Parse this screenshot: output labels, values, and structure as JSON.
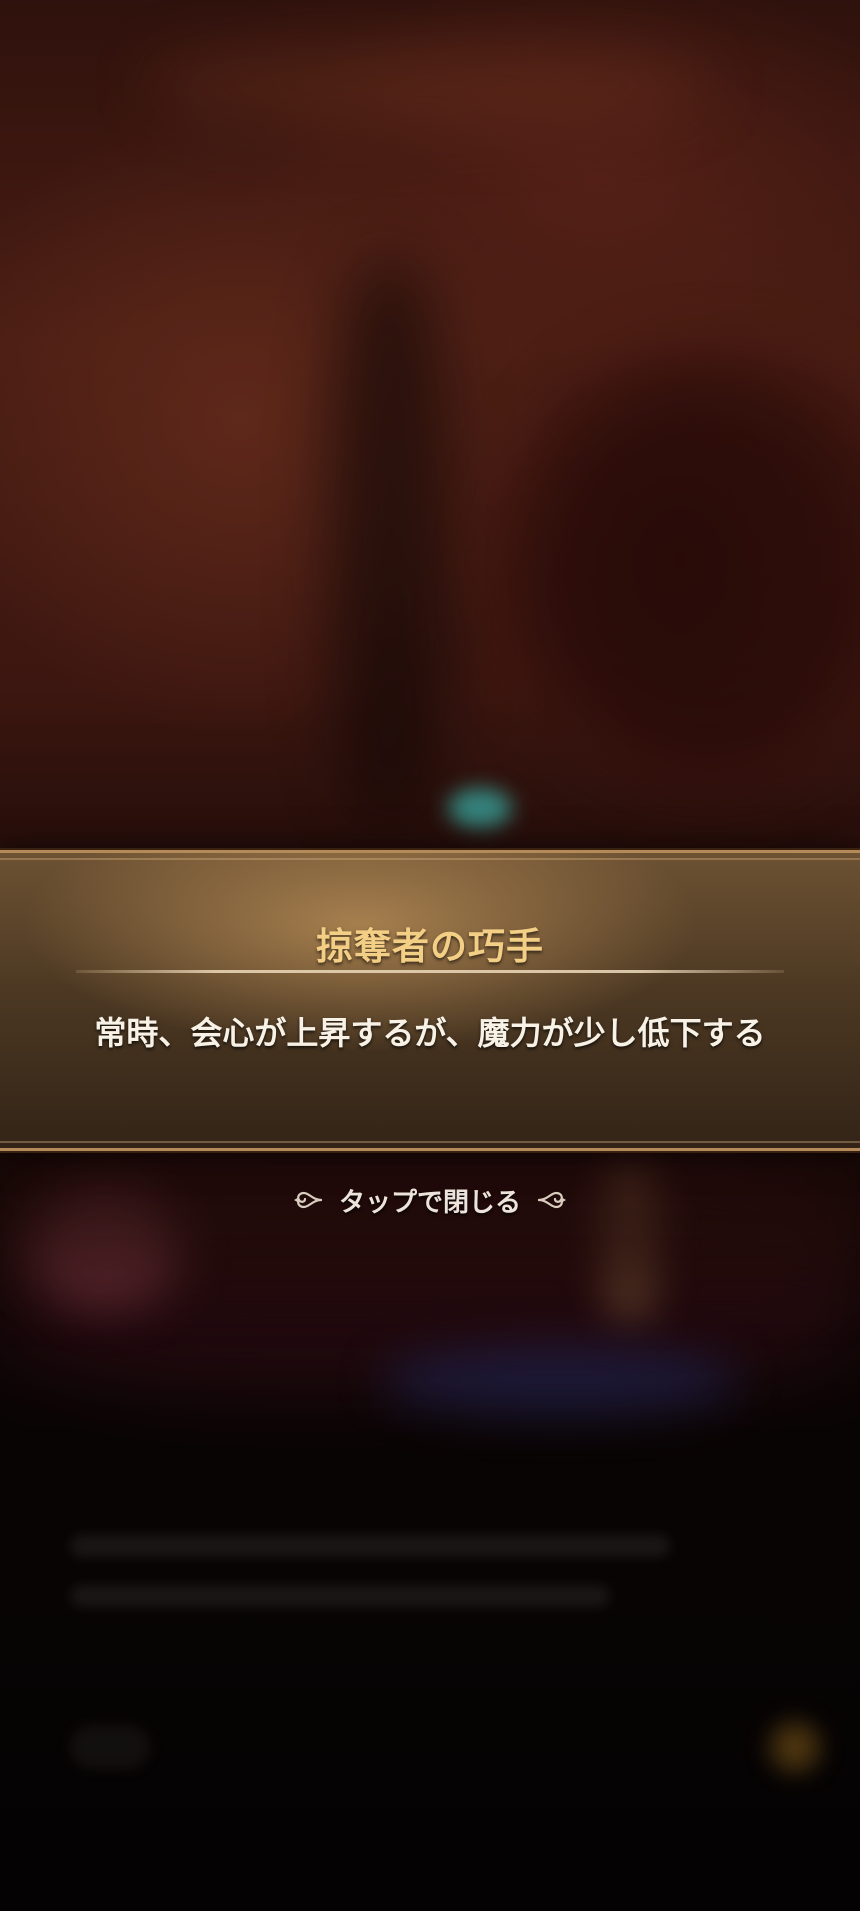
{
  "skill": {
    "title": "掠奪者の巧手",
    "description": "常時、会心が上昇するが、魔力が少し低下する"
  },
  "close_hint": {
    "label": "タップで閉じる",
    "left_icon": "scroll-ornament-left-icon",
    "right_icon": "scroll-ornament-right-icon"
  },
  "colors": {
    "title": "#f3cf86",
    "banner_border": "#b48a58",
    "text": "#f7f1e6"
  }
}
